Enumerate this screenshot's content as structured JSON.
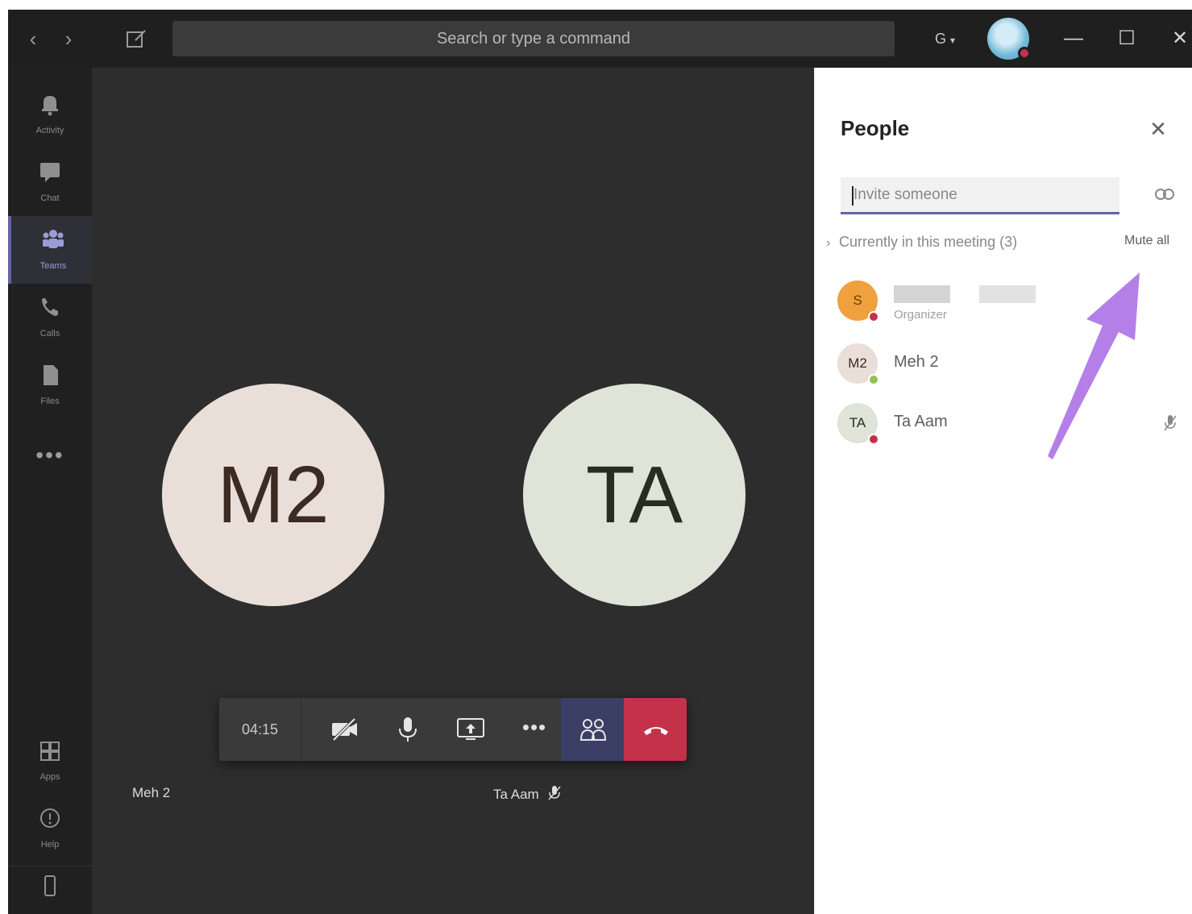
{
  "titlebar": {
    "search_placeholder": "Search or type a command",
    "user_initial": "G",
    "back_glyph": "‹",
    "forward_glyph": "›",
    "minimize_glyph": "—",
    "maximize_glyph": "☐",
    "close_glyph": "✕"
  },
  "rail": {
    "items": [
      {
        "label": "Activity",
        "icon": "bell-icon"
      },
      {
        "label": "Chat",
        "icon": "chat-icon"
      },
      {
        "label": "Teams",
        "icon": "teams-icon"
      },
      {
        "label": "Calls",
        "icon": "phone-icon"
      },
      {
        "label": "Files",
        "icon": "files-icon"
      },
      {
        "label": "Apps",
        "icon": "apps-icon"
      },
      {
        "label": "Help",
        "icon": "help-icon"
      }
    ],
    "more": "•••"
  },
  "stage": {
    "tiles": [
      {
        "initials": "M2",
        "name": "Meh 2"
      },
      {
        "initials": "TA",
        "name": "Ta Aam"
      }
    ],
    "timer": "04:15",
    "more_glyph": "•••"
  },
  "people_panel": {
    "title": "People",
    "close_glyph": "✕",
    "invite_placeholder": "Invite someone",
    "section_label": "Currently in this meeting (3)",
    "section_chevron": "›",
    "mute_all": "Mute all",
    "participants": [
      {
        "initials": "S",
        "name": "",
        "role": "Organizer",
        "avatar_color": "#f0a03c",
        "presence": "#c4314b"
      },
      {
        "initials": "M2",
        "name": "Meh 2",
        "role": "",
        "avatar_color": "#e9dfd8",
        "presence": "#92c353"
      },
      {
        "initials": "TA",
        "name": "Ta Aam",
        "role": "",
        "avatar_color": "#dfe3d8",
        "presence": "#c4314b"
      }
    ]
  },
  "colors": {
    "accent": "#6264a7",
    "hangup": "#c4314b",
    "annotation_arrow": "#b57fe8"
  }
}
